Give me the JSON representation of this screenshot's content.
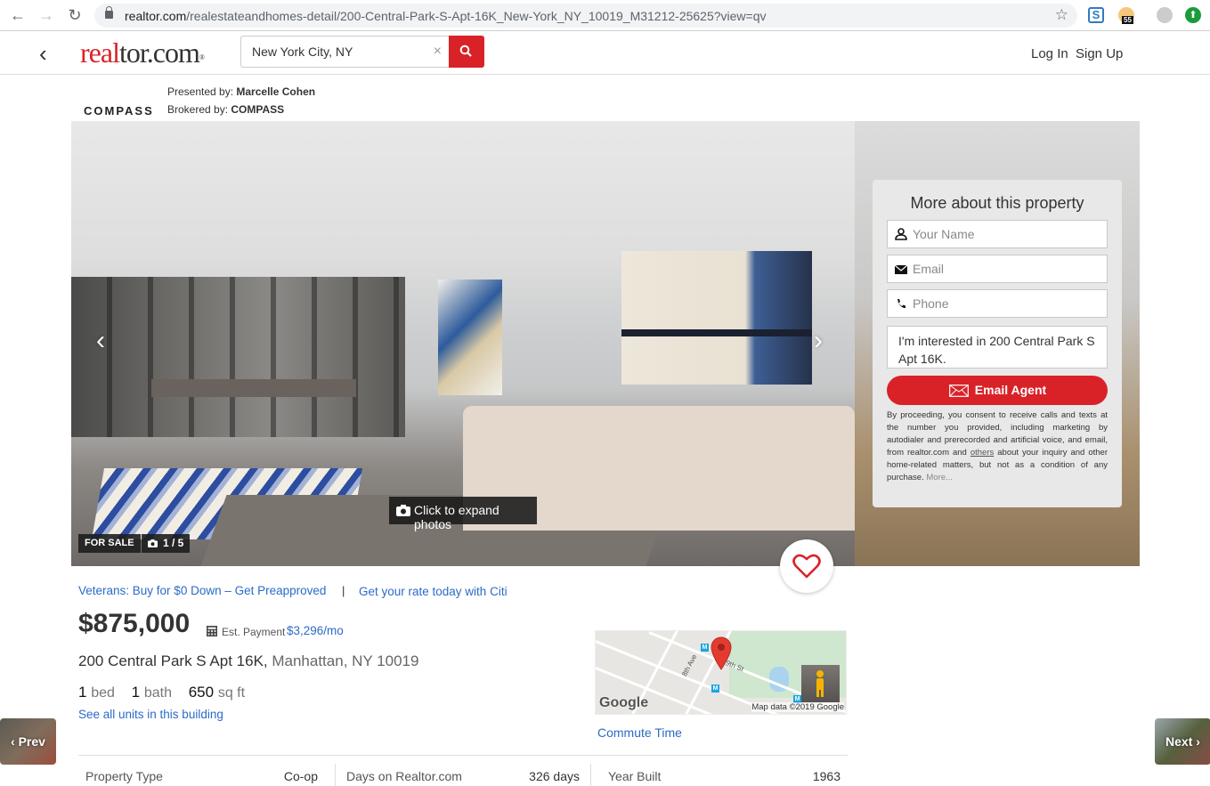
{
  "browser": {
    "url_host": "realtor.com",
    "url_path": "/realestateandhomes-detail/200-Central-Park-S-Apt-16K_New-York_NY_10019_M31212-25625?view=qv",
    "extension_badge": "55"
  },
  "header": {
    "logo_red": "real",
    "logo_dark": "tor.com",
    "logo_reg": "®",
    "search_value": "New York City, NY",
    "clear_symbol": "×",
    "login": "Log In",
    "signup": "Sign Up"
  },
  "broker": {
    "logo_text": "COMPASS",
    "presented_label": "Presented by:",
    "presented_name": "Marcelle Cohen",
    "brokered_label": "Brokered by:",
    "brokered_name": "COMPASS"
  },
  "gallery": {
    "expand_label": "Click to expand photos",
    "status_badge": "FOR SALE",
    "photo_counter": "1 / 5",
    "prev_arrow": "‹",
    "next_arrow": "›"
  },
  "lead_form": {
    "title": "More about this property",
    "name_placeholder": "Your Name",
    "email_placeholder": "Email",
    "phone_placeholder": "Phone",
    "message_value": "I'm interested in 200 Central Park S Apt 16K.",
    "submit_label": "Email Agent",
    "consent_before": "By proceeding, you consent to receive calls and texts at the number you provided, including marketing by autodialer and prerecorded and artificial voice, and email, from realtor.com and ",
    "consent_link": "others",
    "consent_after": " about your inquiry and other home-related matters, but not as a condition of any purchase. ",
    "consent_more": "More..."
  },
  "listing": {
    "veterans_link": "Veterans: Buy for $0 Down – Get Preapproved",
    "separator": "|",
    "citi_link": "Get your rate today with Citi",
    "price": "$875,000",
    "est_payment_label": "Est. Payment",
    "est_payment_value": "$3,296/mo",
    "address_street": "200 Central Park S Apt 16K,",
    "address_city": "Manhattan, NY 10019",
    "beds": "1",
    "beds_unit": "bed",
    "baths": "1",
    "baths_unit": "bath",
    "sqft": "650",
    "sqft_unit": "sq ft",
    "units_link": "See all units in this building"
  },
  "map": {
    "google_label": "Google",
    "attribution": "Map data ©2019 Google",
    "street_label_1": "8th Ave",
    "street_label_2": "W 59th St",
    "commute_link": "Commute Time"
  },
  "properties": [
    {
      "label": "Property Type",
      "value": "Co-op"
    },
    {
      "label": "Days on Realtor.com",
      "value": "326 days"
    },
    {
      "label": "Year Built",
      "value": "1963"
    }
  ],
  "nav": {
    "prev": "Prev",
    "next": "Next"
  },
  "colors": {
    "brand_red": "#d92228",
    "link_blue": "#2b6bc7"
  }
}
